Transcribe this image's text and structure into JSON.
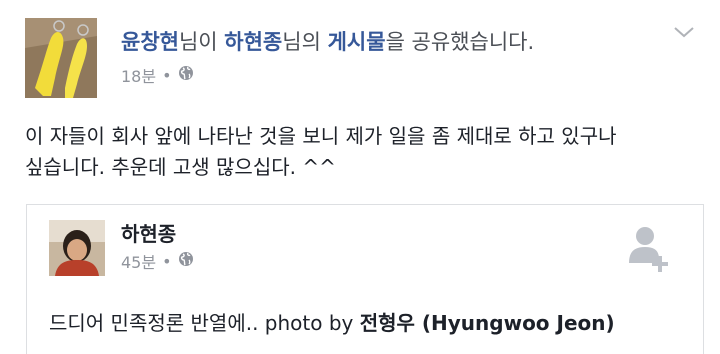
{
  "post": {
    "author": "윤창현",
    "header_part1": "님이 ",
    "shared_from": "하현종",
    "header_part2": "님의 ",
    "object": "게시물",
    "header_part3": "을 공유했습니다.",
    "time": "18분",
    "dot": "•",
    "audience_icon": "globe-icon",
    "menu_icon": "chevron-down-icon",
    "text_line1": "이 자들이 회사 앞에 나타난 것을 보니 제가 일을 좀 제대로 하고 있구나",
    "text_line2": "싶습니다. 추운데 고생 많으십다. ^^"
  },
  "shared_post": {
    "author": "하현종",
    "time": "45분",
    "dot": "•",
    "audience_icon": "globe-icon",
    "add_friend_icon": "add-friend-icon",
    "text_prefix": "드디어 민족정론 반열에.. photo by ",
    "credit_name": "전형우 (Hyungwoo Jeon)"
  },
  "colors": {
    "meta_gray": "#90949c",
    "text": "#1d2129",
    "border": "#dddfe2"
  }
}
